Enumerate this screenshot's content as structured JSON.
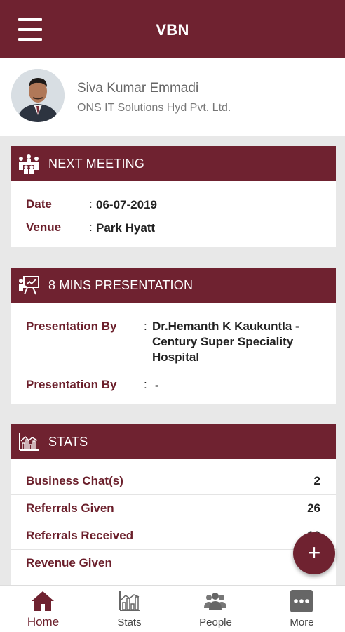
{
  "appbar": {
    "title": "VBN",
    "menu_icon": "hamburger-menu-icon"
  },
  "profile": {
    "name": "Siva Kumar Emmadi",
    "company": "ONS IT Solutions Hyd Pvt. Ltd."
  },
  "next_meeting": {
    "title": "NEXT MEETING",
    "icon": "meeting-icon",
    "rows": [
      {
        "label": "Date",
        "colon": ":",
        "value": "06-07-2019"
      },
      {
        "label": "Venue",
        "colon": ":",
        "value": "Park Hyatt"
      }
    ]
  },
  "presentation": {
    "title": "8 MINS PRESENTATION",
    "icon": "presentation-icon",
    "rows": [
      {
        "label": "Presentation By",
        "colon": ":",
        "value": "Dr.Hemanth K Kaukuntla - Century Super Speciality Hospital"
      },
      {
        "label": "Presentation By",
        "colon": ":",
        "value": "-"
      }
    ]
  },
  "stats": {
    "title": "STATS",
    "icon": "stats-chart-icon",
    "rows": [
      {
        "label": "Business Chat(s)",
        "value": "2"
      },
      {
        "label": "Referrals Given",
        "value": "26"
      },
      {
        "label": "Referrals Received",
        "value": "10"
      },
      {
        "label": "Revenue Given",
        "value": "280"
      }
    ]
  },
  "fab": {
    "label": "+"
  },
  "bottom_nav": [
    {
      "label": "Home",
      "icon": "home-icon",
      "active": true
    },
    {
      "label": "Stats",
      "icon": "stats-icon",
      "active": false
    },
    {
      "label": "People",
      "icon": "people-icon",
      "active": false
    },
    {
      "label": "More",
      "icon": "more-icon",
      "active": false
    }
  ],
  "colors": {
    "primary": "#6f2230",
    "label": "#6b1f2b",
    "background": "#e8e8e8"
  }
}
